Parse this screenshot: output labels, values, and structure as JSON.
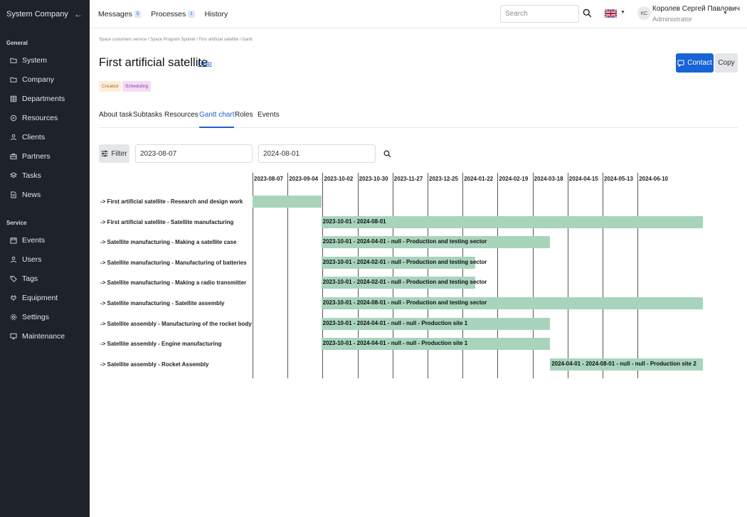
{
  "sidebar": {
    "company": "System Company",
    "sections": [
      {
        "title": "General",
        "items": [
          {
            "label": "System",
            "icon": "folder-icon"
          },
          {
            "label": "Company",
            "icon": "folder-icon"
          },
          {
            "label": "Departments",
            "icon": "grid-icon"
          },
          {
            "label": "Resources",
            "icon": "compass-icon"
          },
          {
            "label": "Clients",
            "icon": "person-icon"
          },
          {
            "label": "Partners",
            "icon": "briefcase-icon"
          },
          {
            "label": "Tasks",
            "icon": "layers-icon"
          },
          {
            "label": "News",
            "icon": "document-icon"
          }
        ]
      },
      {
        "title": "Service",
        "items": [
          {
            "label": "Events",
            "icon": "calendar-icon"
          },
          {
            "label": "Users",
            "icon": "person-icon"
          },
          {
            "label": "Tags",
            "icon": "tag-icon"
          },
          {
            "label": "Equipment",
            "icon": "plug-icon"
          },
          {
            "label": "Settings",
            "icon": "gear-icon"
          },
          {
            "label": "Maintenance",
            "icon": "monitor-icon"
          }
        ]
      }
    ]
  },
  "topbar": {
    "messages_label": "Messages",
    "messages_count": "5",
    "processes_label": "Processes",
    "processes_count": "1",
    "history_label": "History",
    "search_placeholder": "Search",
    "user_initials": "КС",
    "user_name": "Королев Сергей Павлович",
    "user_role": "Administrator"
  },
  "page": {
    "breadcrumb": "Space customers service / Space Program Sputnik / First artificial satellite / Gantt",
    "title": "First artificial satellite",
    "help_label": "Help",
    "contact_label": "Contact",
    "copy_label": "Copy",
    "tags": [
      "Created",
      "Scheduling"
    ],
    "tabs": [
      "About task",
      "Subtasks",
      "Resources",
      "Gantt chart",
      "Roles",
      "Events"
    ],
    "active_tab": "Gantt chart",
    "filter_label": "Filter",
    "date_from": "2023-08-07",
    "date_to": "2024-08-01"
  },
  "gantt": {
    "dates": [
      "2023-08-07",
      "2023-09-04",
      "2023-10-02",
      "2023-10-30",
      "2023-11-27",
      "2023-12-25",
      "2024-01-22",
      "2024-02-19",
      "2024-03-18",
      "2024-04-15",
      "2024-05-13",
      "2024-06-10"
    ],
    "rows": [
      {
        "label": "-> First artificial satellite - Research and design work",
        "start": "2023-08-07",
        "end": "2023-10-01",
        "text": ""
      },
      {
        "label": "-> First artificial satellite - Satellite manufacturing",
        "start": "2023-10-01",
        "end": "2024-08-01",
        "text": "2023-10-01 - 2024-08-01"
      },
      {
        "label": "-> Satellite manufacturing - Making a satellite case",
        "start": "2023-10-01",
        "end": "2024-04-01",
        "text": "2023-10-01 - 2024-04-01 - null - Production and testing sector"
      },
      {
        "label": "-> Satellite manufacturing - Manufacturing of batteries",
        "start": "2023-10-01",
        "end": "2024-02-01",
        "text": "2023-10-01 - 2024-02-01 - null - Production and testing sector"
      },
      {
        "label": "-> Satellite manufacturing - Making a radio transmitter",
        "start": "2023-10-01",
        "end": "2024-02-01",
        "text": "2023-10-01 - 2024-02-01 - null - Production and testing sector"
      },
      {
        "label": "-> Satellite manufacturing - Satellite assembly",
        "start": "2023-10-01",
        "end": "2024-08-01",
        "text": "2023-10-01 - 2024-08-01 - null - Production and testing sector"
      },
      {
        "label": "-> Satellite assembly - Manufacturing of the rocket body",
        "start": "2023-10-01",
        "end": "2024-04-01",
        "text": "2023-10-01 - 2024-04-01 - null - null - Production site 1"
      },
      {
        "label": "-> Satellite assembly - Engine manufacturing",
        "start": "2023-10-01",
        "end": "2024-04-01",
        "text": "2023-10-01 - 2024-04-01 - null - null - Production site 1"
      },
      {
        "label": "-> Satellite assembly - Rocket Assembly",
        "start": "2024-04-01",
        "end": "2024-08-01",
        "text": "2024-04-01 - 2024-08-01 - null - null - Production site 2"
      }
    ]
  }
}
